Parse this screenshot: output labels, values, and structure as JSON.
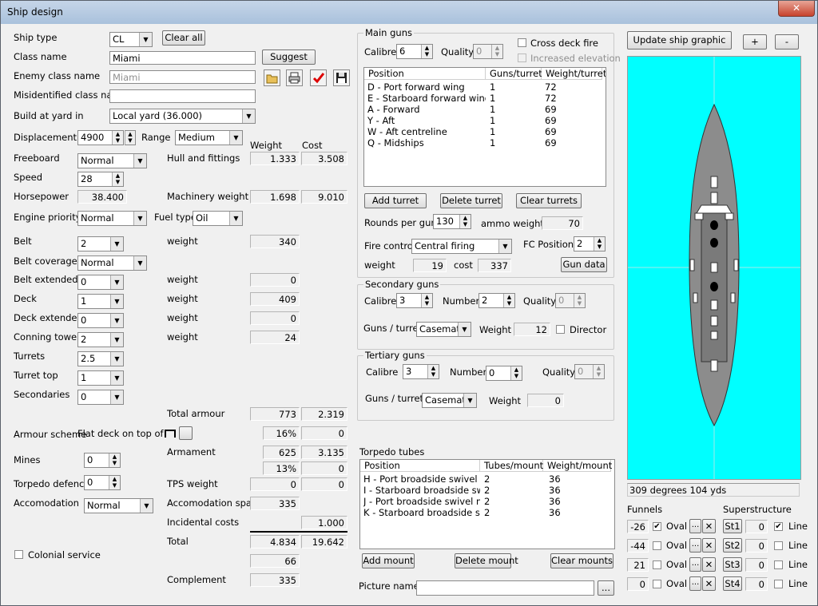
{
  "window": {
    "title": "Ship design",
    "close": "✕"
  },
  "ship_type": {
    "label": "Ship type",
    "value": "CL",
    "clear_all": "Clear all"
  },
  "class_name": {
    "label": "Class name",
    "value": "Miami",
    "suggest": "Suggest"
  },
  "enemy_class": {
    "label": "Enemy class name",
    "value": "Miami"
  },
  "misidentified": {
    "label": "Misidentified class name",
    "value": ""
  },
  "build_yard": {
    "label": "Build at yard in",
    "value": "Local yard (36.000)"
  },
  "displacement": {
    "label": "Displacement",
    "value": "4900",
    "range_label": "Range",
    "range_value": "Medium"
  },
  "headers": {
    "weight": "Weight",
    "cost": "Cost"
  },
  "freeboard": {
    "label": "Freeboard",
    "value": "Normal"
  },
  "hull": {
    "label": "Hull and fittings",
    "weight": "1.333",
    "cost": "3.508"
  },
  "speed": {
    "label": "Speed",
    "value": "28"
  },
  "horsepower": {
    "label": "Horsepower",
    "value": "38.400"
  },
  "machinery": {
    "label": "Machinery weight",
    "weight": "1.698",
    "cost": "9.010"
  },
  "engine_priority": {
    "label": "Engine priority",
    "value": "Normal"
  },
  "fuel": {
    "label": "Fuel type",
    "value": "Oil"
  },
  "belt": {
    "label": "Belt",
    "value": "2",
    "wlabel": "weight",
    "weight": "340"
  },
  "belt_coverage": {
    "label": "Belt coverage",
    "value": "Normal"
  },
  "belt_extended": {
    "label": "Belt extended",
    "value": "0",
    "wlabel": "weight",
    "weight": "0"
  },
  "deck": {
    "label": "Deck",
    "value": "1",
    "wlabel": "weight",
    "weight": "409"
  },
  "deck_extended": {
    "label": "Deck extended",
    "value": "0",
    "wlabel": "weight",
    "weight": "0"
  },
  "conning": {
    "label": "Conning tower",
    "value": "2",
    "wlabel": "weight",
    "weight": "24"
  },
  "turrets": {
    "label": "Turrets",
    "value": "2.5"
  },
  "turret_top": {
    "label": "Turret top",
    "value": "1"
  },
  "secondaries": {
    "label": "Secondaries",
    "value": "0"
  },
  "total_armour": {
    "label": "Total armour",
    "weight": "773",
    "cost": "2.319"
  },
  "armour_scheme": {
    "label": "Armour scheme",
    "value": "Flat deck on top of",
    "pct": "16%",
    "cost": "0"
  },
  "mines": {
    "label": "Mines",
    "value": "0"
  },
  "armament": {
    "label": "Armament",
    "weight": "625",
    "cost": "3.135",
    "pct": "13%",
    "cost2": "0"
  },
  "torpedo_defence": {
    "label": "Torpedo defence",
    "value": "0"
  },
  "tps": {
    "label": "TPS weight",
    "weight": "0",
    "cost": "0"
  },
  "accomodation": {
    "label": "Accomodation",
    "value": "Normal",
    "space_label": "Accomodation space",
    "space": "335"
  },
  "incidental": {
    "label": "Incidental costs",
    "cost": "1.000"
  },
  "total": {
    "label": "Total",
    "weight": "4.834",
    "cost": "19.642",
    "extra": "66"
  },
  "colonial": {
    "label": "Colonial service"
  },
  "complement": {
    "label": "Complement",
    "value": "335"
  },
  "main_guns": {
    "caption": "Main guns",
    "calibre_label": "Calibre",
    "calibre": "6",
    "quality_label": "Quality",
    "quality": "0",
    "cross_deck": "Cross deck fire",
    "increased_elev": "Increased elevation",
    "columns": [
      "Position",
      "Guns/turret",
      "Weight/turret"
    ],
    "rows": [
      {
        "pos": "D - Port forward wing",
        "guns": "1",
        "weight": "72"
      },
      {
        "pos": "E - Starboard forward wing",
        "guns": "1",
        "weight": "72"
      },
      {
        "pos": "A - Forward",
        "guns": "1",
        "weight": "69"
      },
      {
        "pos": "Y - Aft",
        "guns": "1",
        "weight": "69"
      },
      {
        "pos": "W - Aft centreline",
        "guns": "1",
        "weight": "69"
      },
      {
        "pos": "Q - Midships",
        "guns": "1",
        "weight": "69"
      }
    ],
    "add_turret": "Add turret",
    "delete_turret": "Delete turret",
    "clear_turrets": "Clear turrets",
    "rounds_label": "Rounds per gun",
    "rounds": "130",
    "ammo_label": "ammo weight",
    "ammo": "70",
    "fire_control_label": "Fire control",
    "fire_control": "Central firing",
    "fc_positions_label": "FC Positions",
    "fc_positions": "2",
    "weight_label": "weight",
    "weight": "19",
    "cost_label": "cost",
    "cost": "337",
    "gun_data": "Gun data"
  },
  "secondary_guns": {
    "caption": "Secondary guns",
    "calibre_label": "Calibre",
    "calibre": "3",
    "number_label": "Number",
    "number": "2",
    "quality_label": "Quality",
    "quality": "0",
    "mount_label": "Guns / turret",
    "mount": "Casemates",
    "weight_label": "Weight",
    "weight": "12",
    "director": "Director"
  },
  "tertiary_guns": {
    "caption": "Tertiary guns",
    "calibre_label": "Calibre",
    "calibre": "3",
    "number_label": "Number",
    "number": "0",
    "quality_label": "Quality",
    "quality": "0",
    "mount_label": "Guns / turret",
    "mount": "Casemates",
    "weight_label": "Weight",
    "weight": "0"
  },
  "torpedo": {
    "caption": "Torpedo tubes",
    "columns": [
      "Position",
      "Tubes/mount",
      "Weight/mount"
    ],
    "rows": [
      {
        "pos": "H - Port broadside swivel mo...",
        "tubes": "2",
        "weight": "36"
      },
      {
        "pos": "I - Starboard broadside swiv...",
        "tubes": "2",
        "weight": "36"
      },
      {
        "pos": "J - Port broadside swivel mo...",
        "tubes": "2",
        "weight": "36"
      },
      {
        "pos": "K - Starboard broadside swiv...",
        "tubes": "2",
        "weight": "36"
      }
    ],
    "add": "Add mount",
    "delete": "Delete mount",
    "clear": "Clear mounts"
  },
  "picture": {
    "label": "Picture name",
    "value": "",
    "browse": "..."
  },
  "graphic": {
    "update": "Update ship graphic",
    "plus": "+",
    "minus": "-",
    "status": "309 degrees 104 yds",
    "bg": "#00ffff"
  },
  "funnels": {
    "label": "Funnels",
    "rows": [
      {
        "value": "-26",
        "checked": "✔",
        "shape": "Oval"
      },
      {
        "value": "-44",
        "checked": "",
        "shape": "Oval"
      },
      {
        "value": "21",
        "checked": "",
        "shape": "Oval"
      },
      {
        "value": "0",
        "checked": "",
        "shape": "Oval"
      }
    ],
    "more": "...",
    "del": "✕"
  },
  "superstructure": {
    "label": "Superstructure",
    "rows": [
      {
        "btn": "St1",
        "value": "0",
        "checked": "✔",
        "line": "Line"
      },
      {
        "btn": "St2",
        "value": "0",
        "checked": "",
        "line": "Line"
      },
      {
        "btn": "St3",
        "value": "0",
        "checked": "",
        "line": "Line"
      },
      {
        "btn": "St4",
        "value": "0",
        "checked": "",
        "line": "Line"
      }
    ]
  }
}
